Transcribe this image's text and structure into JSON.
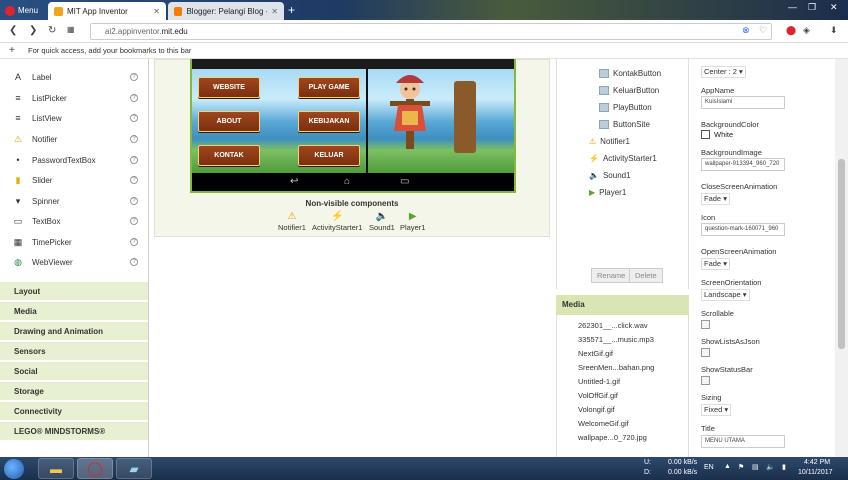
{
  "browser": {
    "menu_label": "Menu",
    "tabs": [
      {
        "title": "MIT App Inventor",
        "active": true
      },
      {
        "title": "Blogger: Pelangi Blog - Se",
        "active": false
      }
    ],
    "url_prefix": "ai2.appinventor.",
    "url_host": "mit.edu",
    "bookmarks_hint": "For quick access, add your bookmarks to this bar"
  },
  "palette": {
    "items": [
      {
        "label": "Label",
        "icon": "A"
      },
      {
        "label": "ListPicker",
        "icon": "≡"
      },
      {
        "label": "ListView",
        "icon": "≡"
      },
      {
        "label": "Notifier",
        "icon": "⚠"
      },
      {
        "label": "PasswordTextBox",
        "icon": "•"
      },
      {
        "label": "Slider",
        "icon": "▮"
      },
      {
        "label": "Spinner",
        "icon": "▾"
      },
      {
        "label": "TextBox",
        "icon": "▭"
      },
      {
        "label": "TimePicker",
        "icon": "▦"
      },
      {
        "label": "WebViewer",
        "icon": "◍"
      }
    ],
    "categories": [
      "Layout",
      "Media",
      "Drawing and Animation",
      "Sensors",
      "Social",
      "Storage",
      "Connectivity",
      "LEGO® MINDSTORMS®"
    ]
  },
  "viewer": {
    "buttons_left": [
      "WEBSITE",
      "ABOUT",
      "KONTAK"
    ],
    "buttons_right": [
      "PLAY GAME",
      "KEBIJAKAN",
      "KELUAR"
    ],
    "nonvisible_title": "Non-visible components",
    "nonvisible": [
      {
        "label": "Notifier1",
        "icon": "⚠"
      },
      {
        "label": "ActivityStarter1",
        "icon": "⚡"
      },
      {
        "label": "Sound1",
        "icon": "🔈"
      },
      {
        "label": "Player1",
        "icon": "▶"
      }
    ]
  },
  "components": {
    "buttons": [
      "KontakButton",
      "KeluarButton",
      "PlayButton",
      "ButtonSite"
    ],
    "others": [
      {
        "label": "Notifier1",
        "icon": "⚠"
      },
      {
        "label": "ActivityStarter1",
        "icon": "⚡"
      },
      {
        "label": "Sound1",
        "icon": "🔈"
      },
      {
        "label": "Player1",
        "icon": "▶"
      }
    ],
    "rename_label": "Rename",
    "delete_label": "Delete"
  },
  "media": {
    "title": "Media",
    "files": [
      "262301__...click.wav",
      "335571__...music.mp3",
      "NextGif.gif",
      "SreenMen...bahan.png",
      "Untitled-1.gif",
      "VolOffGif.gif",
      "Volongif.gif",
      "WelcomeGif.gif",
      "wallpape...0_720.jpg"
    ]
  },
  "properties": {
    "align_value": "Center : 2",
    "appname_label": "AppName",
    "appname_value": "KuisIslami",
    "bgcolor_label": "BackgroundColor",
    "bgcolor_value": "White",
    "bgimage_label": "BackgroundImage",
    "bgimage_value": "wallpaper-913394_960_720",
    "close_anim_label": "CloseScreenAnimation",
    "close_anim_value": "Fade",
    "icon_label": "Icon",
    "icon_value": "question-mark-160071_960",
    "open_anim_label": "OpenScreenAnimation",
    "open_anim_value": "Fade",
    "orientation_label": "ScreenOrientation",
    "orientation_value": "Landscape",
    "scrollable_label": "Scrollable",
    "showlists_label": "ShowListsAsJson",
    "showstatus_label": "ShowStatusBar",
    "sizing_label": "Sizing",
    "sizing_value": "Fixed",
    "title_label": "Title",
    "title_value": "MENU UTAMA"
  },
  "taskbar": {
    "net_up": "0.00 kB/s",
    "net_down": "0.00 kB/s",
    "drive_u": "U:",
    "drive_d": "D:",
    "lang": "EN",
    "time": "4:42 PM",
    "date": "10/11/2017"
  }
}
